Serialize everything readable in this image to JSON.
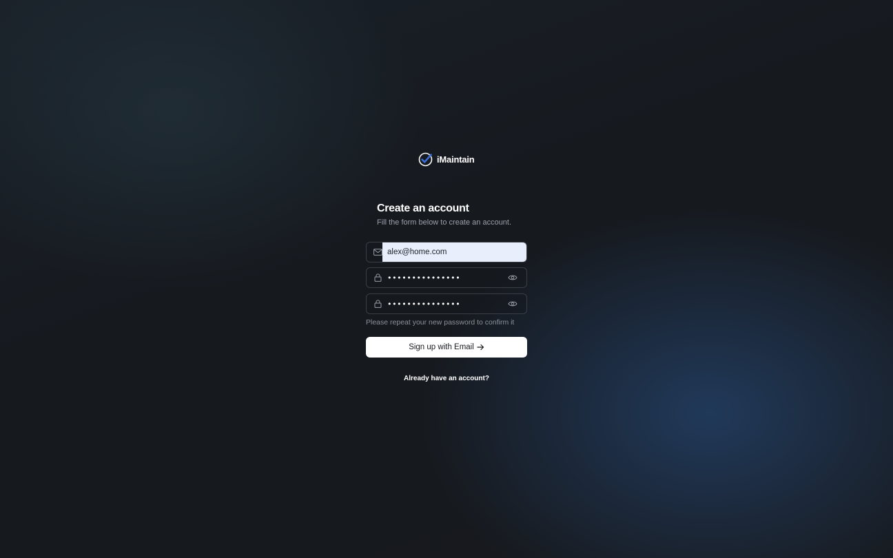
{
  "brand": {
    "name": "iMaintain",
    "logo_icon": "check-circle-icon",
    "accent_color": "#3b6fd8"
  },
  "form": {
    "title": "Create an account",
    "subtitle": "Fill the form below to create an account.",
    "email": {
      "icon": "mail-icon",
      "value": "alex@home.com"
    },
    "password": {
      "icon": "lock-icon",
      "value": "•••••••••••••••",
      "toggle_icon": "eye-icon"
    },
    "confirm_password": {
      "icon": "lock-icon",
      "value": "•••••••••••••••",
      "toggle_icon": "eye-icon",
      "hint": "Please repeat your new password to confirm it"
    },
    "submit_label": "Sign up with Email",
    "submit_icon": "arrow-right-icon",
    "signin_link": "Already have an account?"
  }
}
